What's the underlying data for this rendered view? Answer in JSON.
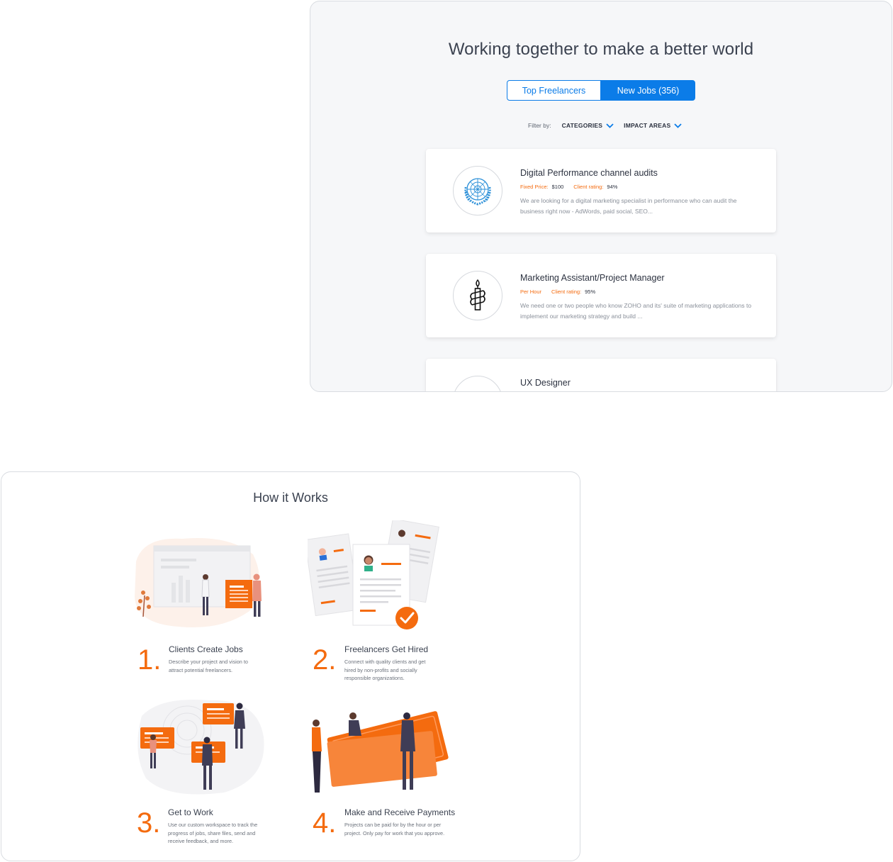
{
  "jobs_panel": {
    "title": "Working together to make a better world",
    "tabs": [
      {
        "label": "Top Freelancers",
        "active": false
      },
      {
        "label": "New Jobs (356)",
        "active": true
      }
    ],
    "filter": {
      "label": "Filter by:",
      "dropdowns": [
        "CATEGORIES",
        "IMPACT AREAS"
      ]
    },
    "jobs": [
      {
        "title": "Digital Performance channel audits",
        "price_label": "Fixed Price:",
        "price_value": "$100",
        "rating_label": "Client rating:",
        "rating_value": "94%",
        "description": "We are looking for a digital marketing specialist in performance who can  audit the business right now - AdWords, paid social, SEO...",
        "logo": "un-emblem-icon"
      },
      {
        "title": "Marketing Assistant/Project Manager",
        "price_label": "Per Hour",
        "price_value": "",
        "rating_label": "Client rating:",
        "rating_value": "95%",
        "description": "We need one or two people who know ZOHO and its' suite of marketing applications to implement our marketing strategy and build ...",
        "logo": "amnesty-candle-icon"
      },
      {
        "title": "UX Designer",
        "logo": "bird-logo-icon"
      }
    ],
    "colors": {
      "accent": "#0b7ce8",
      "orange": "#f46b0f"
    }
  },
  "how_it_works": {
    "title": "How it Works",
    "steps": [
      {
        "number": "1",
        "title": "Clients Create Jobs",
        "description": "Describe your project and vision to attract potential freelancers."
      },
      {
        "number": "2",
        "title": "Freelancers Get Hired",
        "description": "Connect with quality clients and get hired by non-profits and socially responsible organizations."
      },
      {
        "number": "3",
        "title": "Get to Work",
        "description": "Use our custom workspace to track the progress of jobs, share files, send and receive feedback, and more."
      },
      {
        "number": "4",
        "title": "Make and Receive Payments",
        "description": "Projects can be paid for by the hour or per project. Only pay for work that you approve."
      }
    ]
  }
}
